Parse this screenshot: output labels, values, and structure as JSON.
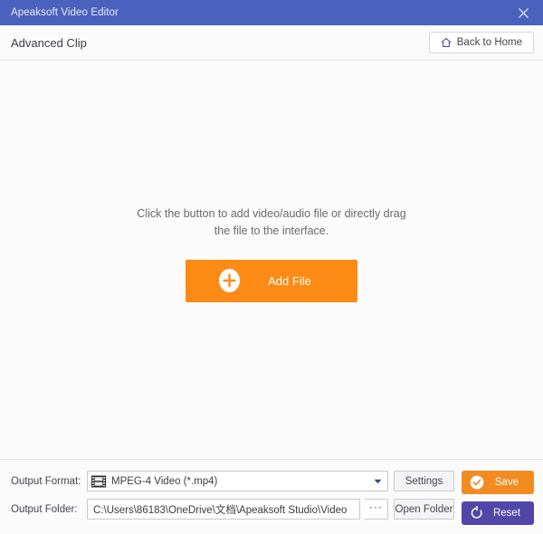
{
  "window": {
    "title": "Apeaksoft Video Editor",
    "close_icon": "close-icon",
    "titlebar_color": "#4a62bd"
  },
  "header": {
    "page_title": "Advanced Clip",
    "back_home": {
      "label": "Back to Home",
      "icon": "home-icon",
      "icon_color": "#5147a8"
    }
  },
  "main": {
    "drop_hint": "Click the button to add video/audio file or directly drag the file to the interface.",
    "add_file": {
      "label": "Add File",
      "icon": "plus-circle-icon",
      "color": "#fb8b15"
    }
  },
  "output": {
    "format_label": "Output Format:",
    "format_value": "MPEG-4 Video (*.mp4)",
    "format_icon": "film-strip-icon",
    "dropdown_icon": "chevron-down-icon",
    "settings_label": "Settings",
    "folder_label": "Output Folder:",
    "folder_value": "C:\\Users\\86183\\OneDrive\\文档\\Apeaksoft Studio\\Video",
    "browse_label": "···",
    "open_folder_label": "Open Folder",
    "save": {
      "label": "Save",
      "icon": "check-circle-icon",
      "color": "#f28b20"
    },
    "reset": {
      "label": "Reset",
      "icon": "reset-arrow-icon",
      "color": "#5147a8"
    }
  }
}
